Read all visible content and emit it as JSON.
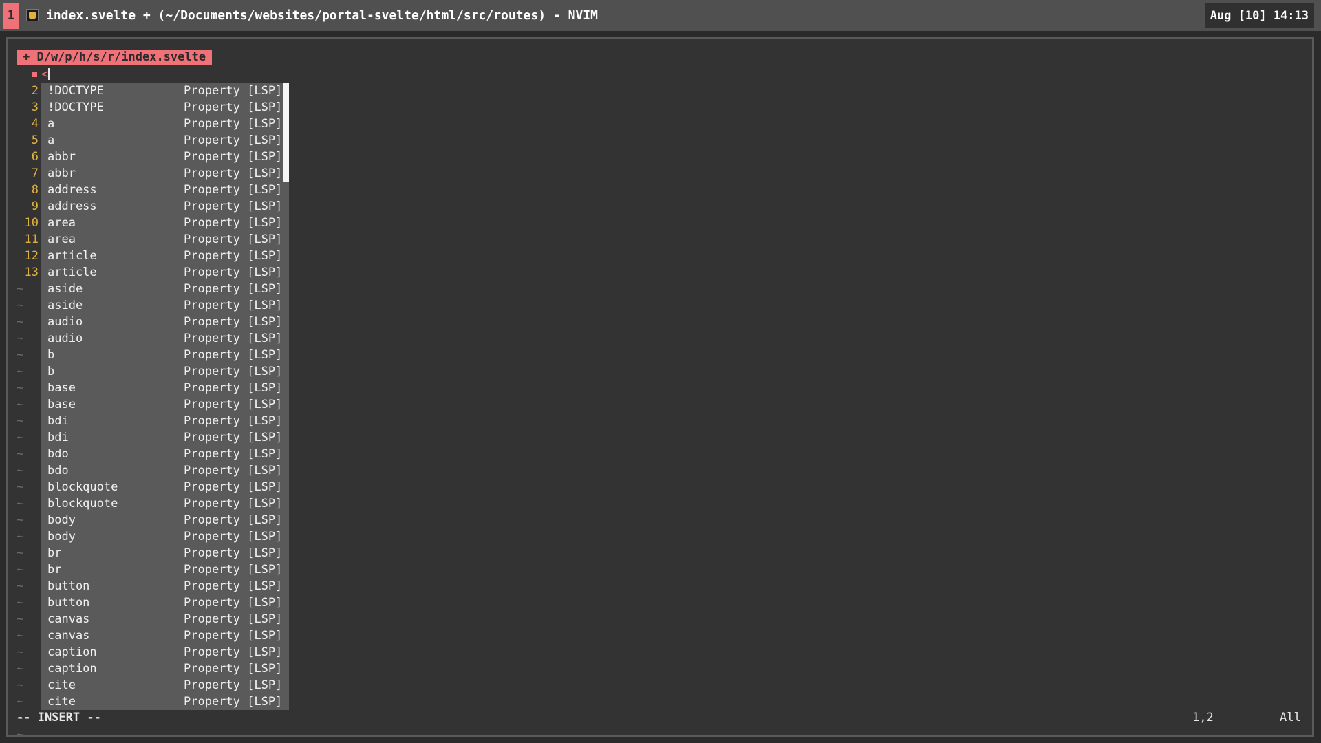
{
  "topbar": {
    "workspace": "1",
    "app_icon": "terminal-icon",
    "title": "index.svelte + (~/Documents/websites/portal-svelte/html/src/routes) - NVIM",
    "clock": "Aug [10] 14:13"
  },
  "editor": {
    "tab_label": "+ D/w/p/h/s/r/index.svelte",
    "line1_text": "<",
    "gutter": [
      "",
      "2",
      "3",
      "4",
      "5",
      "6",
      "7",
      "8",
      "9",
      "10",
      "11",
      "12",
      "13",
      "~",
      "~",
      "~",
      "~",
      "~",
      "~",
      "~",
      "~",
      "~",
      "~",
      "~",
      "~",
      "~",
      "~",
      "~",
      "~",
      "~",
      "~",
      "~",
      "~",
      "~",
      "~",
      "~",
      "~",
      "~",
      "~",
      "~",
      "~"
    ]
  },
  "popup": {
    "kind_label": "Property [LSP]",
    "items": [
      "!DOCTYPE",
      "!DOCTYPE",
      "a",
      "a",
      "abbr",
      "abbr",
      "address",
      "address",
      "area",
      "area",
      "article",
      "article",
      "aside",
      "aside",
      "audio",
      "audio",
      "b",
      "b",
      "base",
      "base",
      "bdi",
      "bdi",
      "bdo",
      "bdo",
      "blockquote",
      "blockquote",
      "body",
      "body",
      "br",
      "br",
      "button",
      "button",
      "canvas",
      "canvas",
      "caption",
      "caption",
      "cite",
      "cite"
    ]
  },
  "statusline": {
    "mode": "-- INSERT --",
    "position": "1,2",
    "scroll": "All"
  },
  "colors": {
    "accent": "#f07178",
    "line_number": "#e0b040",
    "background": "#333333",
    "popup_bg": "#5a5a5a"
  }
}
